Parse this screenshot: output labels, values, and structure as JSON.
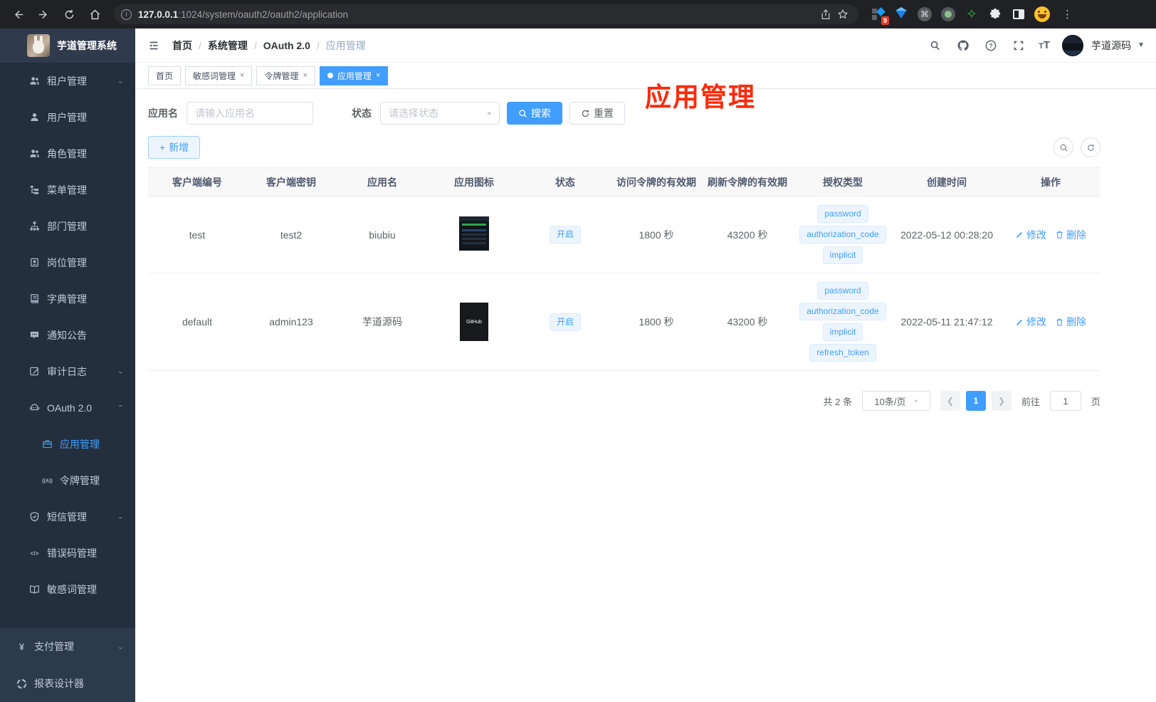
{
  "browser": {
    "url_host": "127.0.0.1",
    "url_rest": ":1024/system/oauth2/oauth2/application",
    "extension_badge": "9"
  },
  "sidebar": {
    "logo_title": "芋道管理系统",
    "submenu_items": [
      {
        "label": "租户管理",
        "icon": "users-icon",
        "arrow": "down"
      },
      {
        "label": "用户管理",
        "icon": "user-icon"
      },
      {
        "label": "角色管理",
        "icon": "users-icon"
      },
      {
        "label": "菜单管理",
        "icon": "menu-tree-icon"
      },
      {
        "label": "部门管理",
        "icon": "org-chart-icon"
      },
      {
        "label": "岗位管理",
        "icon": "badge-icon"
      },
      {
        "label": "字典管理",
        "icon": "dictionary-icon"
      },
      {
        "label": "通知公告",
        "icon": "message-icon"
      },
      {
        "label": "审计日志",
        "icon": "edit-log-icon",
        "arrow": "down"
      },
      {
        "label": "OAuth 2.0",
        "icon": "robot-icon",
        "arrow": "up"
      },
      {
        "label": "应用管理",
        "icon": "briefcase-icon",
        "child": true,
        "active": true
      },
      {
        "label": "令牌管理",
        "icon": "token-icon",
        "child": true
      },
      {
        "label": "短信管理",
        "icon": "shield-icon",
        "arrow": "down"
      },
      {
        "label": "错误码管理",
        "icon": "code-icon"
      },
      {
        "label": "敏感词管理",
        "icon": "open-book-icon"
      }
    ],
    "root_items": [
      {
        "label": "支付管理",
        "icon": "yen-icon",
        "arrow": "down"
      },
      {
        "label": "报表设计器",
        "icon": "report-icon"
      }
    ]
  },
  "header": {
    "breadcrumb": [
      "首页",
      "系统管理",
      "OAuth 2.0",
      "应用管理"
    ],
    "username": "芋道源码",
    "right_icons": [
      "search-icon",
      "github-icon",
      "help-icon",
      "fullscreen-icon",
      "font-size-icon"
    ]
  },
  "tabs": [
    {
      "label": "首页",
      "closable": false,
      "active": false
    },
    {
      "label": "敏感词管理",
      "closable": true,
      "active": false
    },
    {
      "label": "令牌管理",
      "closable": true,
      "active": false
    },
    {
      "label": "应用管理",
      "closable": true,
      "active": true
    }
  ],
  "annotation_text": "应用管理",
  "filters": {
    "name_label": "应用名",
    "name_placeholder": "请输入应用名",
    "status_label": "状态",
    "status_placeholder": "请选择状态",
    "search_label": "搜索",
    "reset_label": "重置",
    "add_label": "新增"
  },
  "table": {
    "columns": [
      "客户端编号",
      "客户端密钥",
      "应用名",
      "应用图标",
      "状态",
      "访问令牌的有效期",
      "刷新令牌的有效期",
      "授权类型",
      "创建时间",
      "操作"
    ],
    "rows": [
      {
        "client_id": "test",
        "client_secret": "test2",
        "app_name": "biubiu",
        "icon_style": "screenshot",
        "icon_label": "",
        "status": "开启",
        "access_token_ttl": "1800 秒",
        "refresh_token_ttl": "43200 秒",
        "grant_types": [
          "password",
          "authorization_code",
          "implicit"
        ],
        "created_at": "2022-05-12 00:28:20"
      },
      {
        "client_id": "default",
        "client_secret": "admin123",
        "app_name": "芋道源码",
        "icon_style": "github",
        "icon_label": "GitHub",
        "status": "开启",
        "access_token_ttl": "1800 秒",
        "refresh_token_ttl": "43200 秒",
        "grant_types": [
          "password",
          "authorization_code",
          "implicit",
          "refresh_token"
        ],
        "created_at": "2022-05-11 21:47:12"
      }
    ],
    "edit_label": "修改",
    "delete_label": "删除"
  },
  "pagination": {
    "total_text": "共 2 条",
    "page_size_text": "10条/页",
    "current_page": "1",
    "goto_label": "前往",
    "goto_value": "1",
    "page_suffix": "页"
  },
  "colors": {
    "accent": "#409eff",
    "tag_bg": "#ecf5ff",
    "tag_border": "#d9ecff",
    "sidebar_bg": "#242f3e",
    "sidebar_root_bg": "#2d3a4c",
    "annotation_red": "#fb2b0b",
    "active_tab_bg": "#409eff"
  }
}
